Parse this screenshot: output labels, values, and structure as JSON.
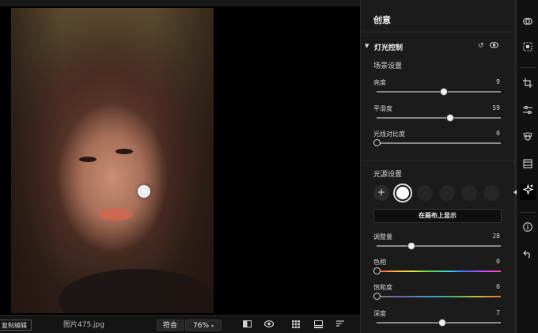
{
  "canvas": {
    "light_handle": "light-source-handle"
  },
  "bottombar": {
    "edit_label": "复制编辑",
    "filename": "图片475.jpg",
    "fit_label": "符合",
    "zoom_label": "76%",
    "icons": [
      "compare-icon",
      "eye-icon",
      "grid-icon",
      "filmstrip-icon",
      "sort-icon"
    ]
  },
  "panel": {
    "title": "创意",
    "section": {
      "title": "灯光控制",
      "reset_icon": "reset-icon",
      "visibility_icon": "eye-icon"
    },
    "scene": {
      "title": "场景设置",
      "sliders": [
        {
          "label": "亮度",
          "value": "9",
          "fraction": 0.54
        },
        {
          "label": "平滑度",
          "value": "59",
          "fraction": 0.59
        },
        {
          "label": "光线对比度",
          "value": "0",
          "fraction": 0.0
        }
      ]
    },
    "source": {
      "title": "光源设置",
      "add_symbol": "+",
      "show_on_canvas": "在画布上显示",
      "sliders": [
        {
          "label": "调整量",
          "value": "28",
          "fraction": 0.28,
          "track": "plain"
        },
        {
          "label": "色相",
          "value": "0",
          "fraction": 0.0,
          "track": "hue"
        },
        {
          "label": "饱和度",
          "value": "0",
          "fraction": 0.0,
          "track": "sat"
        },
        {
          "label": "深度",
          "value": "7",
          "fraction": 0.53,
          "track": "plain"
        }
      ]
    }
  },
  "rail": {
    "icons": [
      "layers-icon",
      "select-icon",
      "crop-icon",
      "adjust-icon",
      "portrait-icon",
      "erase-icon",
      "creative-icon",
      "info-icon",
      "undo-icon"
    ],
    "active": "creative-icon"
  },
  "colors": {
    "panel_bg": "#1b1b1b",
    "canvas_bg": "#000000",
    "accent": "#ffffff"
  }
}
